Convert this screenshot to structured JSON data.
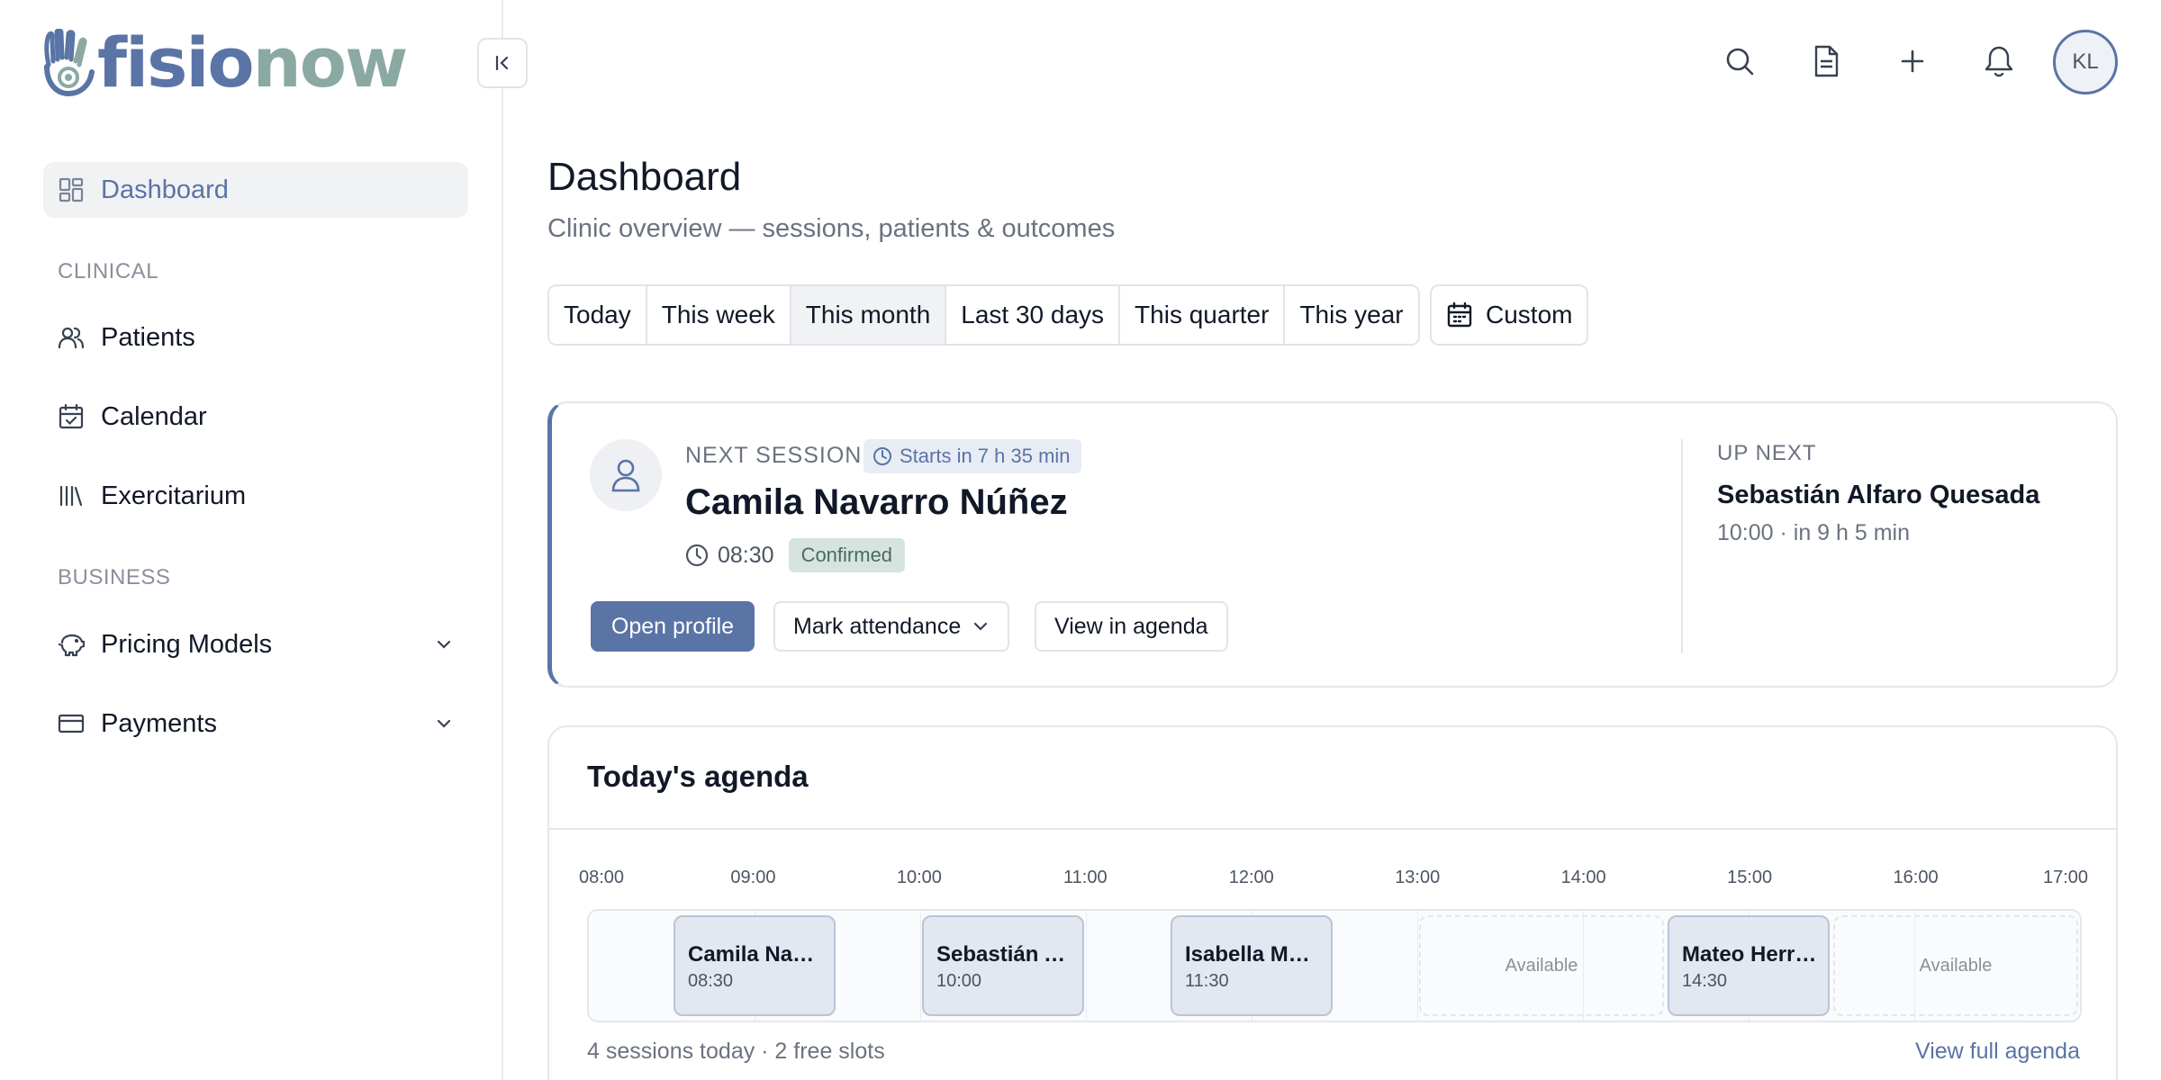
{
  "brand": {
    "logo_part1": "fisio",
    "logo_part2": "now",
    "color_primary": "#5a74a6",
    "color_secondary": "#8aa9a3"
  },
  "sidebar": {
    "collapse_icon": "collapse-left-icon",
    "dashboard": {
      "label": "Dashboard",
      "icon": "grid-icon",
      "active": true
    },
    "section_clinical": "CLINICAL",
    "clinical_items": [
      {
        "label": "Patients",
        "icon": "users-icon"
      },
      {
        "label": "Calendar",
        "icon": "calendar-check-icon"
      },
      {
        "label": "Exercitarium",
        "icon": "library-icon"
      }
    ],
    "section_business": "BUSINESS",
    "business_items": [
      {
        "label": "Pricing Models",
        "icon": "piggy-bank-icon",
        "expandable": true
      },
      {
        "label": "Payments",
        "icon": "credit-card-icon",
        "expandable": true
      }
    ]
  },
  "topbar": {
    "icons": [
      "search-icon",
      "document-icon",
      "plus-icon",
      "bell-icon"
    ],
    "avatar_initials": "KL"
  },
  "page": {
    "title": "Dashboard",
    "subtitle": "Clinic overview — sessions, patients & outcomes"
  },
  "date_range": {
    "options": [
      "Today",
      "This week",
      "This month",
      "Last 30 days",
      "This quarter",
      "This year"
    ],
    "selected": "This month",
    "custom_label": "Custom"
  },
  "next_session": {
    "label": "NEXT SESSION",
    "starts_in": "Starts in 7 h 35 min",
    "patient": "Camila Navarro Núñez",
    "time": "08:30",
    "status": "Confirmed",
    "btn_open_profile": "Open profile",
    "btn_mark_attendance": "Mark attendance",
    "btn_view_agenda": "View in agenda",
    "up_next_label": "UP NEXT",
    "up_next_name": "Sebastián Alfaro Quesada",
    "up_next_time": "10:00 · in 9 h 5 min"
  },
  "agenda": {
    "title": "Today's agenda",
    "hours": [
      "08:00",
      "09:00",
      "10:00",
      "11:00",
      "12:00",
      "13:00",
      "14:00",
      "15:00",
      "16:00",
      "17:00"
    ],
    "slots": [
      {
        "type": "session",
        "name": "Camila Navarro Núñez",
        "start": "08:30",
        "hours": [
          8.5,
          9.5
        ]
      },
      {
        "type": "session",
        "name": "Sebastián Alfaro Quesada",
        "start": "10:00",
        "hours": [
          10.0,
          11.0
        ]
      },
      {
        "type": "session",
        "name": "Isabella Mora",
        "start": "11:30",
        "hours": [
          11.5,
          12.5
        ]
      },
      {
        "type": "available",
        "label": "Available",
        "hours": [
          13.0,
          14.5
        ]
      },
      {
        "type": "session",
        "name": "Mateo Herrera",
        "start": "14:30",
        "hours": [
          14.5,
          15.5
        ]
      },
      {
        "type": "available",
        "label": "Available",
        "hours": [
          15.5,
          17.0
        ]
      }
    ],
    "summary": "4 sessions today · 2 free slots",
    "link": "View full agenda"
  }
}
